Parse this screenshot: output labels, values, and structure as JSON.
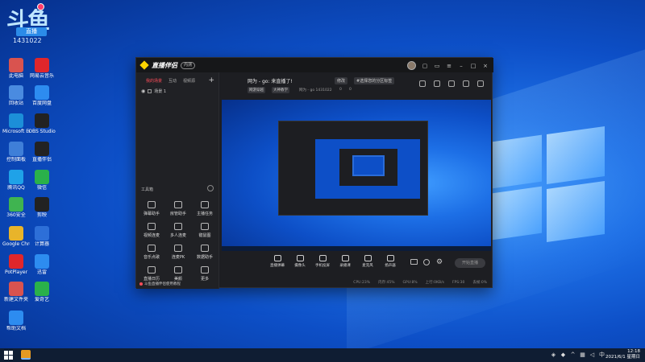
{
  "desktop_brand": {
    "logo_text": "斗鱼",
    "tag": "直播",
    "number": "1431022"
  },
  "desktop_icons": [
    {
      "label": "此电脑",
      "color": "#d9534f"
    },
    {
      "label": "网易云音乐",
      "color": "#e0262b"
    },
    {
      "label": "回收站",
      "color": "#4a8be0"
    },
    {
      "label": "百度网盘",
      "color": "#2d8cf0"
    },
    {
      "label": "Microsoft Edge",
      "color": "#1c8fd8"
    },
    {
      "label": "OBS Studio",
      "color": "#222"
    },
    {
      "label": "控制面板",
      "color": "#3f7fd8"
    },
    {
      "label": "直播伴侣",
      "color": "#222"
    },
    {
      "label": "腾讯QQ",
      "color": "#1fa2e8"
    },
    {
      "label": "微信",
      "color": "#2ab14a"
    },
    {
      "label": "360安全",
      "color": "#3fb450"
    },
    {
      "label": "剪映",
      "color": "#222"
    },
    {
      "label": "Google Chrome",
      "color": "#e8b42a"
    },
    {
      "label": "计算器",
      "color": "#2d6fd8"
    },
    {
      "label": "PotPlayer",
      "color": "#e0262b"
    },
    {
      "label": "迅雷",
      "color": "#2d8cf0"
    },
    {
      "label": "新建文件夹",
      "color": "#d9534f"
    },
    {
      "label": "爱奇艺",
      "color": "#2ab14a"
    },
    {
      "label": "帮助文档",
      "color": "#2d8cf0"
    }
  ],
  "app": {
    "name": "直播伴侣",
    "version": "内测",
    "tabs": [
      "我的场景",
      "互动",
      "视频源"
    ],
    "scene": "场景 1",
    "tools_heading": "工具箱",
    "tools": [
      "弹幕助手",
      "房管助手",
      "主播任务",
      "视频连麦",
      "多人连麦",
      "键鼠图",
      "音乐点歌",
      "连麦PK",
      "数据助手",
      "直播日历",
      "美颜",
      "更多"
    ],
    "notice": "斗鱼直播伴侣使用教程",
    "room_title": "网为 - go: 来直播了!",
    "room_chips": [
      "修改",
      "#选择您的分区标签"
    ],
    "sub_chips": [
      "网游穿越",
      "大神教学"
    ],
    "room_info": "网为 - go  1431022",
    "room_stats": [
      "0",
      "0"
    ],
    "controls": [
      "直播弹幕",
      "摄像头",
      "手机投屏",
      "录播课",
      "麦克风",
      "扬声器"
    ],
    "go_live": "开始直播",
    "status": [
      "CPU:23%",
      "内存:45%",
      "GPU:8%",
      "上行:0KB/s",
      "FPS:30",
      "丢帧:0%"
    ]
  },
  "taskbar": {
    "time": "12:18",
    "date": "2021/6/1 星期日"
  }
}
